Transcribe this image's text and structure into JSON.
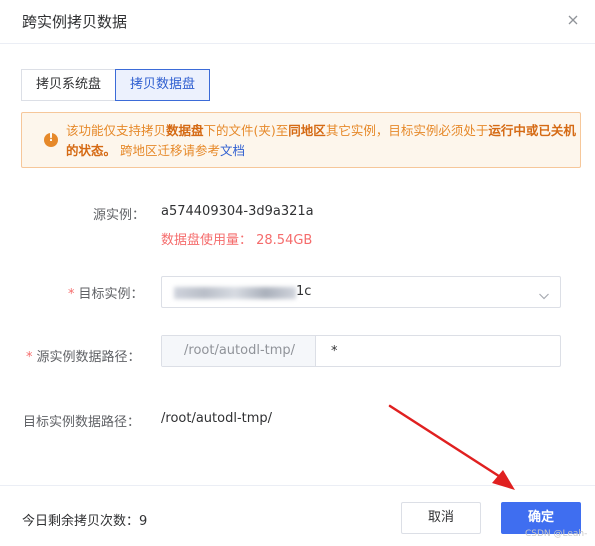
{
  "dialog": {
    "title": "跨实例拷贝数据"
  },
  "tabs": [
    {
      "label": "拷贝系统盘",
      "active": false
    },
    {
      "label": "拷贝数据盘",
      "active": true
    }
  ],
  "alert": {
    "p1": "该功能仅支持拷贝",
    "b1": "数据盘",
    "p2": "下的文件(夹)至",
    "b2": "同地区",
    "p3": "其它实例，目标实例必须处于",
    "b3": "运行中或已关机的状态。",
    "p4": " 跨地区迁移请参考",
    "link": "文档"
  },
  "form": {
    "source_label": "源实例：",
    "source_value": "a574409304-3d9a321a",
    "usage": "数据盘使用量： 28.54GB",
    "target_label": "目标实例：",
    "target_value_suffix": "1c",
    "source_path_label": "源实例数据路径：",
    "source_path_prefix": "/root/autodl-tmp/",
    "source_path_value": "*",
    "target_path_label": "目标实例数据路径：",
    "target_path_value": "/root/autodl-tmp/",
    "required_mark": "*"
  },
  "footer": {
    "remaining": "今日剩余拷贝次数：9",
    "cancel": "取消",
    "ok": "确定"
  },
  "watermark": "CSDN @Leah-",
  "colors": {
    "primary": "#3f6ef0",
    "warning": "#e6892a",
    "danger": "#f56c6c",
    "annotation": "#e02020"
  }
}
